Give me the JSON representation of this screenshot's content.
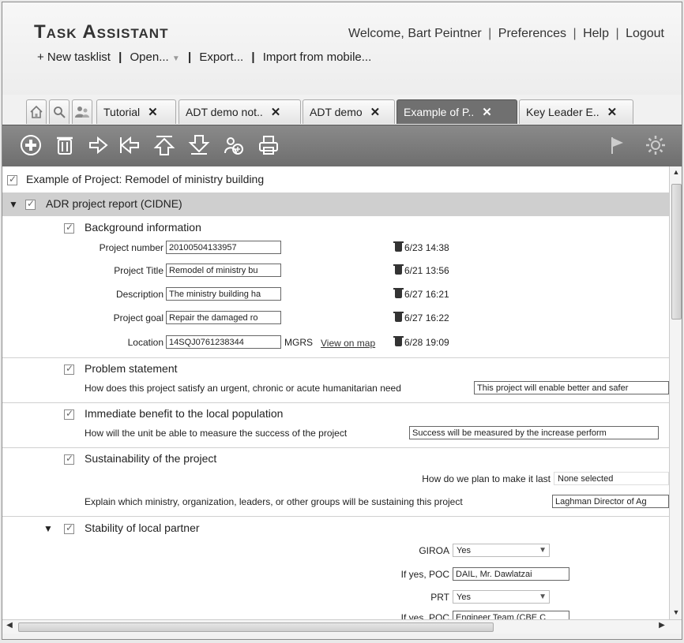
{
  "header": {
    "app_title": "Task Assistant",
    "welcome": "Welcome, Bart Peintner",
    "links": [
      "Preferences",
      "Help",
      "Logout"
    ],
    "actions": {
      "new_tasklist": "+ New tasklist",
      "open": "Open...",
      "export": "Export...",
      "import": "Import from mobile..."
    }
  },
  "tabs": [
    {
      "label": "Tutorial"
    },
    {
      "label": "ADT demo not.."
    },
    {
      "label": "ADT demo"
    },
    {
      "label": "Example of P.."
    },
    {
      "label": "Key Leader E.."
    }
  ],
  "content": {
    "root_label": "Example of Project: Remodel of ministry building",
    "section_title": "ADR project report (CIDNE)",
    "background": {
      "title": "Background information",
      "fields": [
        {
          "label": "Project number",
          "value": "20100504133957",
          "stamp": "6/23 14:38"
        },
        {
          "label": "Project Title",
          "value": "Remodel of ministry bu",
          "stamp": "6/21 13:56"
        },
        {
          "label": "Description",
          "value": "The ministry building ha",
          "stamp": "6/27 16:21"
        },
        {
          "label": "Project goal",
          "value": "Repair the damaged ro",
          "stamp": "6/27 16:22"
        },
        {
          "label": "Location",
          "value": "14SQJ0761238344",
          "unit": "MGRS",
          "link": "View on map",
          "stamp": "6/28 19:09"
        }
      ]
    },
    "problem": {
      "title": "Problem statement",
      "question": "How does this project satisfy an urgent, chronic or acute humanitarian need",
      "answer": "This project will enable better and safer"
    },
    "benefit": {
      "title": "Immediate benefit to the local population",
      "question": "How will the unit be able to measure the success of the project",
      "answer": "Success will be measured by the increase perform"
    },
    "sustainability": {
      "title": "Sustainability of the project",
      "q1": "How do we plan to make it last",
      "a1": "None selected",
      "q2": "Explain which ministry, organization, leaders, or other groups will be sustaining this project",
      "a2": "Laghman Director of Ag"
    },
    "stability": {
      "title": "Stability of local partner",
      "giroa_label": "GIROA",
      "giroa_value": "Yes",
      "poc1_label": "If yes, POC",
      "poc1_value": "DAIL, Mr. Dawlatzai",
      "prt_label": "PRT",
      "prt_value": "Yes",
      "poc2_label": "If yes, POC",
      "poc2_value": "Engineer Team (CBE C"
    }
  }
}
